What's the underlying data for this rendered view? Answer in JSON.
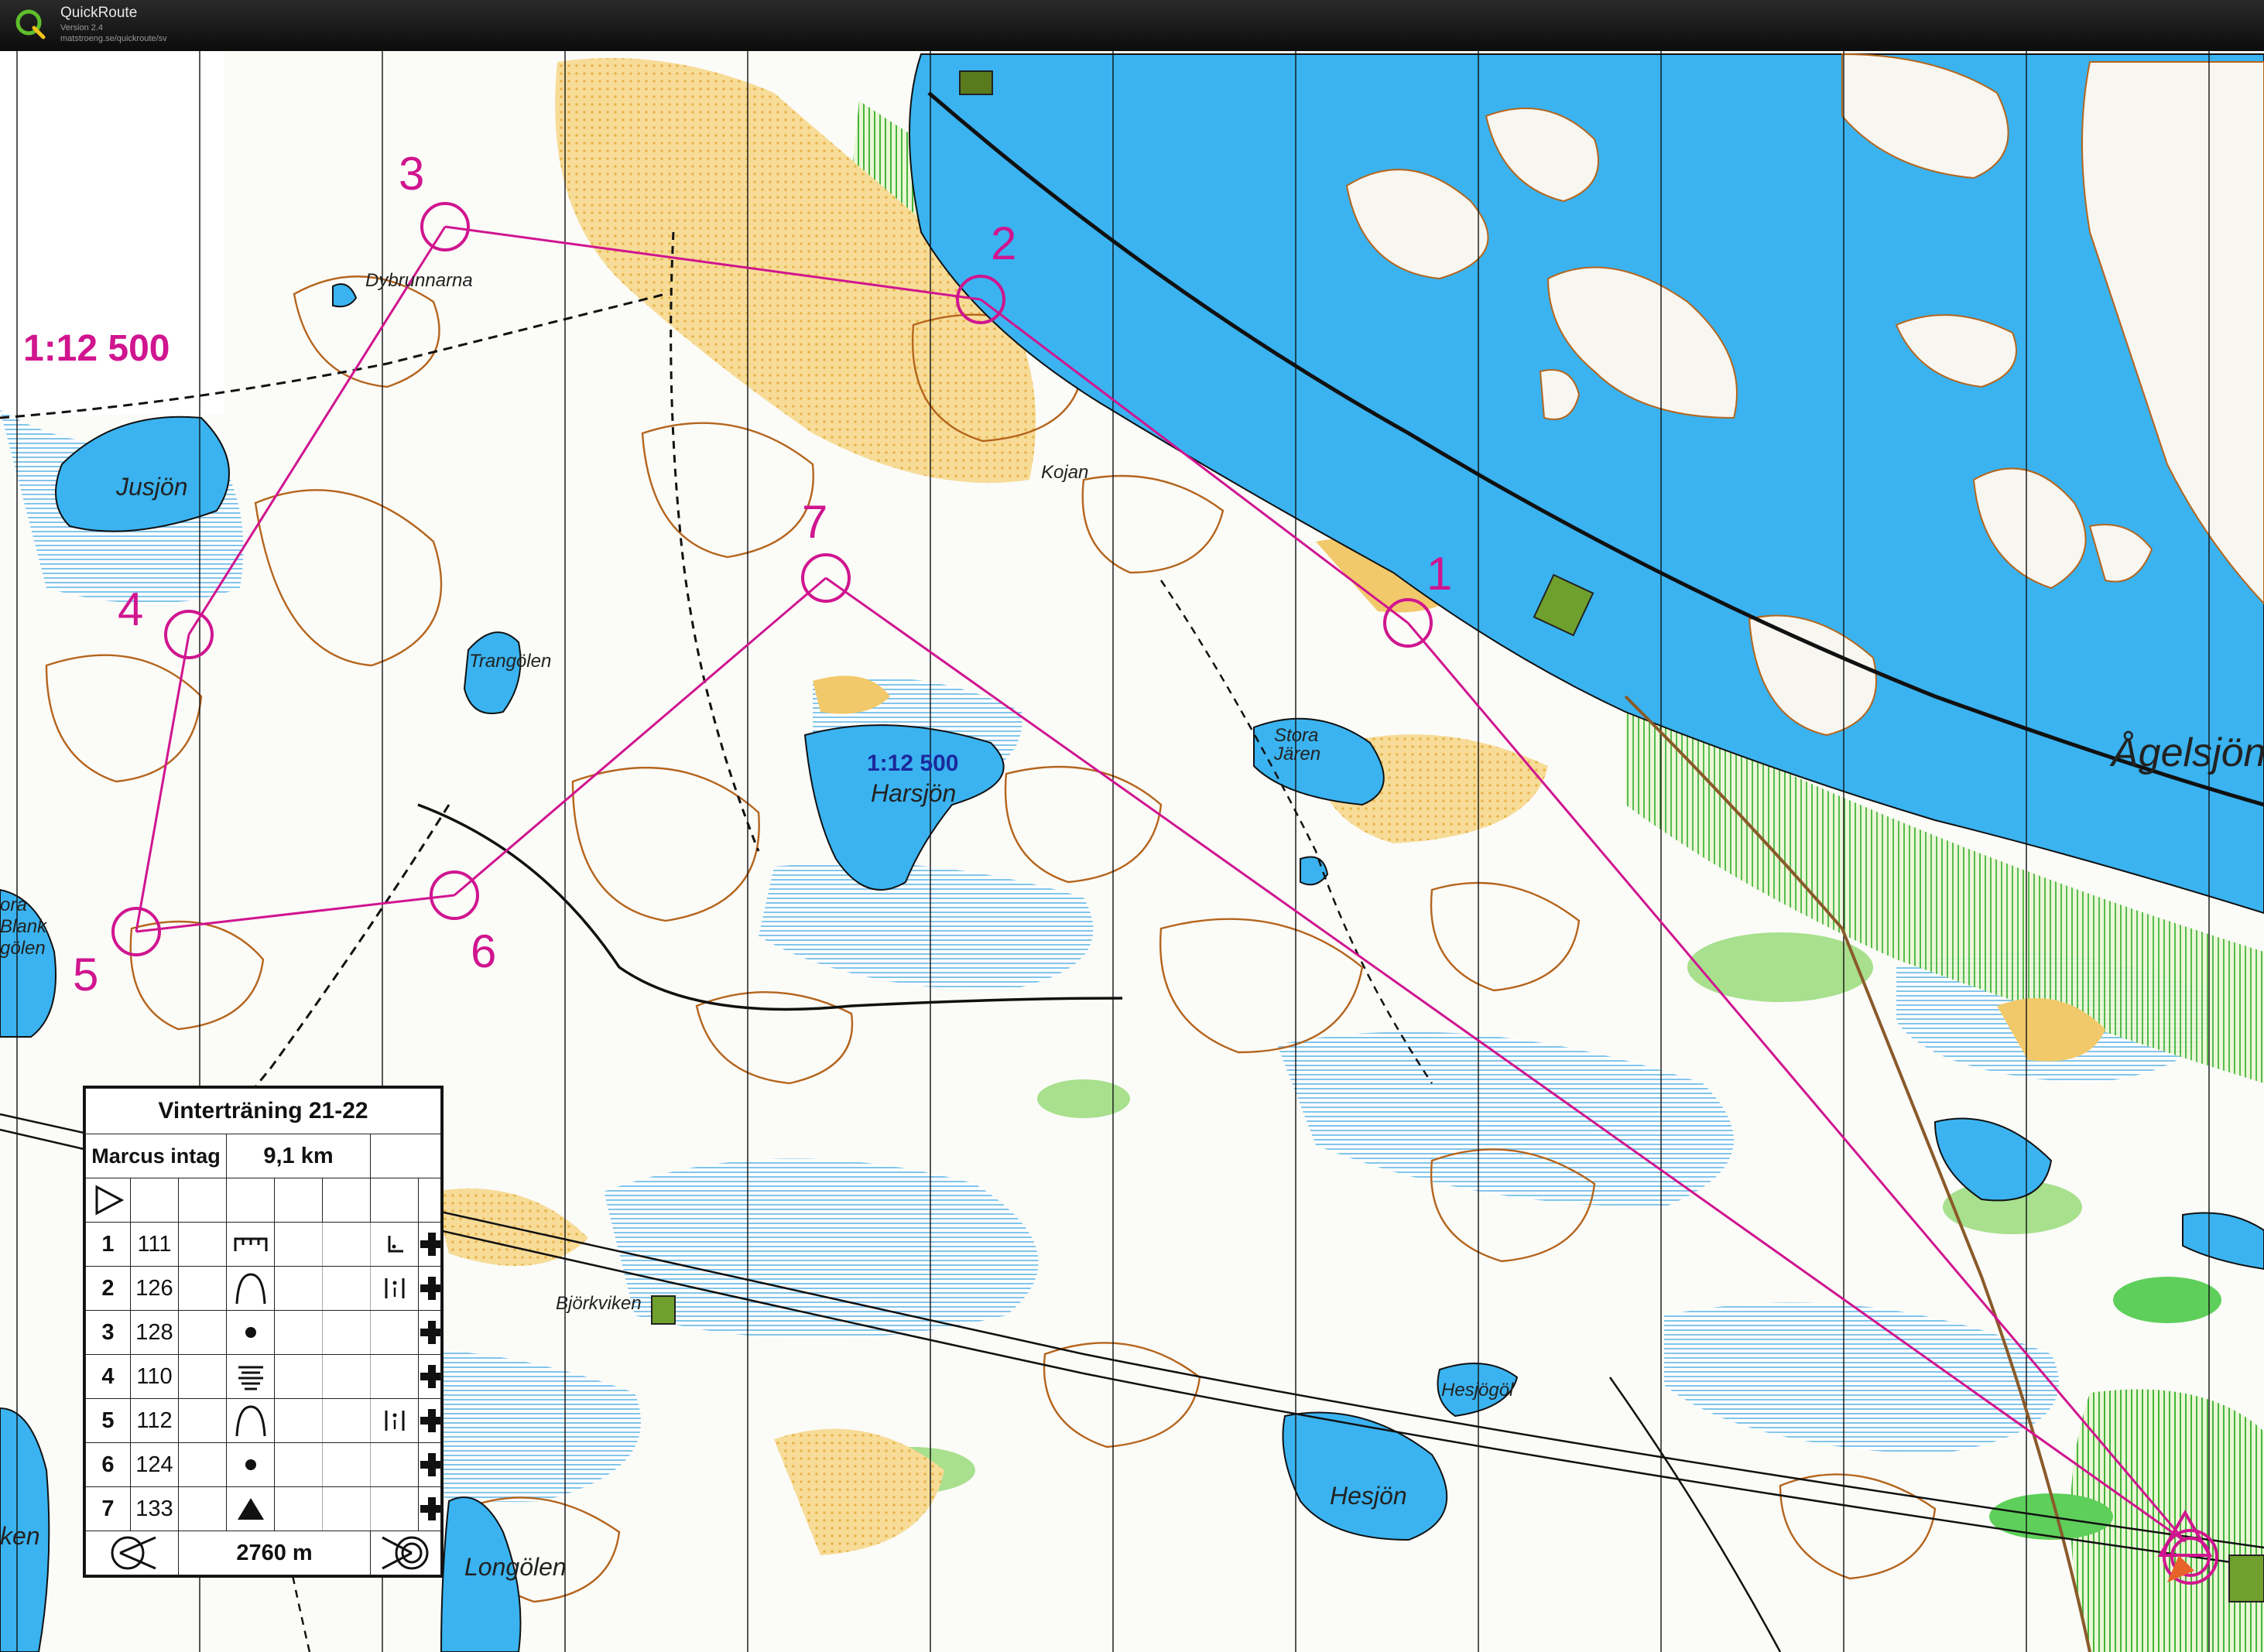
{
  "app": {
    "name": "QuickRoute",
    "version": "Version 2.4",
    "url": "matstroeng.se/quickroute/sv"
  },
  "map": {
    "scale_label": "1:12 500",
    "scale_label_inner": "1:12 500",
    "place_names": {
      "dybrunnarna": "Dybrunnarna",
      "jusjon": "Jusjön",
      "trangolen": "Trangölen",
      "kojan": "Kojan",
      "harsjon": "Harsjön",
      "stora_jaren_1": "Stora",
      "stora_jaren_2": "Jären",
      "agelsjon": "Ågelsjön",
      "stora_blank_1": "ora",
      "stora_blank_2": "Blank",
      "stora_blank_3": "gölen",
      "bjorkviken": "Björkviken",
      "hesjogol": "Hesjögöl",
      "hesjon": "Hesjön",
      "longolen": "Longölen",
      "viken": "ken"
    },
    "control_numbers": [
      "1",
      "2",
      "3",
      "4",
      "5",
      "6",
      "7"
    ],
    "colors": {
      "course": "#d0158f",
      "water": "#3ab3f0",
      "contour": "#b5651d",
      "open_land": "#f2c96a",
      "green": "#5ecf5a",
      "marsh": "#63b8e8"
    }
  },
  "description_sheet": {
    "title": "Vinterträning 21-22",
    "course_name": "Marcus intag",
    "course_length": "9,1 km",
    "start_symbol": "start-triangle",
    "rows": [
      {
        "number": "1",
        "code": "111",
        "feature": "ruin-symbol",
        "detail": "corner-symbol",
        "extra": "first-aid-cross"
      },
      {
        "number": "2",
        "code": "126",
        "feature": "knoll-symbol",
        "detail": "between-symbol",
        "extra": "first-aid-cross"
      },
      {
        "number": "3",
        "code": "128",
        "feature": "dot-symbol",
        "detail": "",
        "extra": "first-aid-cross"
      },
      {
        "number": "4",
        "code": "110",
        "feature": "terraces-symbol",
        "detail": "",
        "extra": "first-aid-cross"
      },
      {
        "number": "5",
        "code": "112",
        "feature": "knoll-symbol",
        "detail": "between-symbol",
        "extra": "first-aid-cross"
      },
      {
        "number": "6",
        "code": "124",
        "feature": "dot-symbol",
        "detail": "",
        "extra": "first-aid-cross"
      },
      {
        "number": "7",
        "code": "133",
        "feature": "triangle-symbol",
        "detail": "",
        "extra": "first-aid-cross"
      }
    ],
    "finish_distance": "2760 m"
  }
}
